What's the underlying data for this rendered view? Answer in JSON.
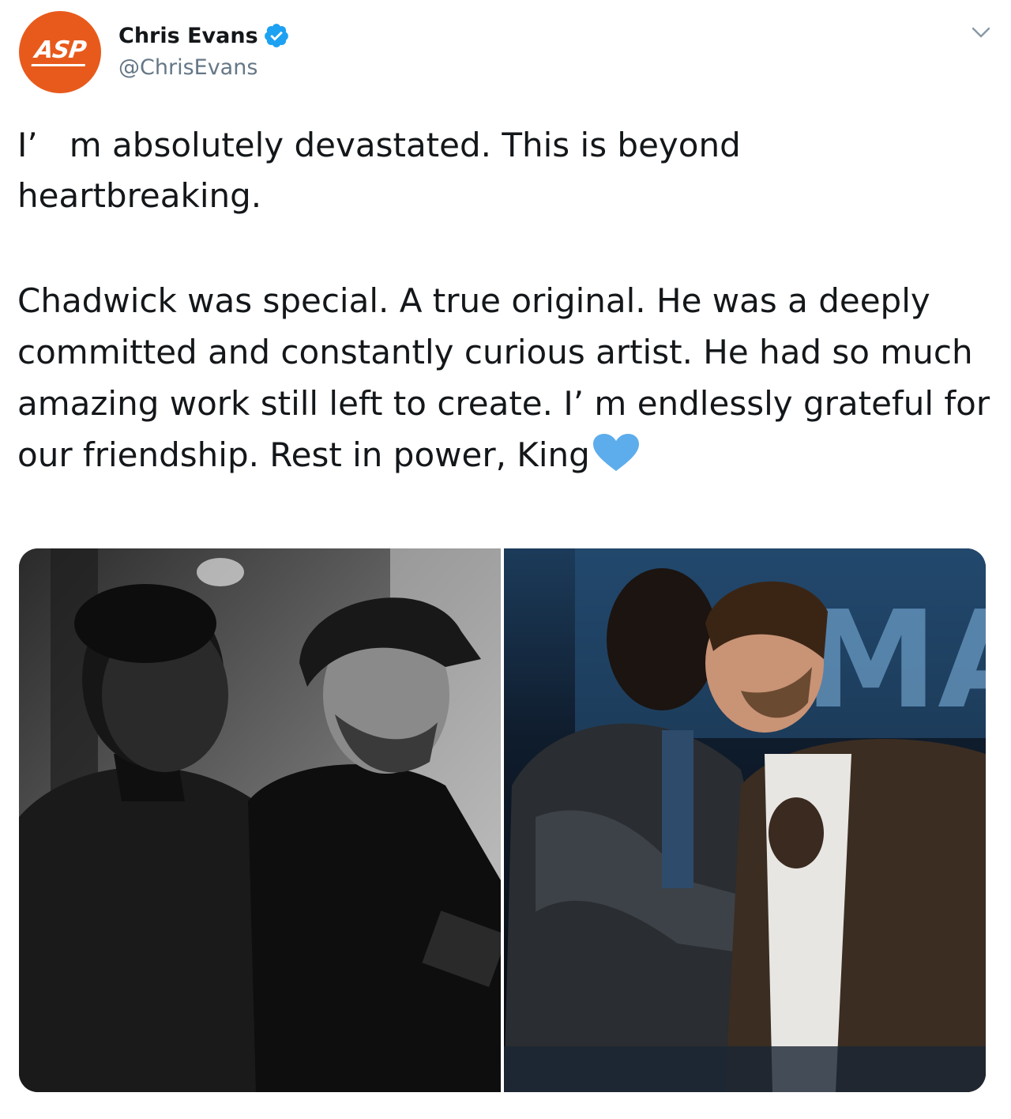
{
  "tweet": {
    "avatar_text": "ASP",
    "display_name": "Chris Evans",
    "handle": "@ChrisEvans",
    "paragraph1": "I’   m absolutely devastated. This is beyond\nheartbreaking.",
    "paragraph2": "Chadwick was special. A true original. He was a deeply committed and constantly curious artist. He had so much amazing work still left to create. I’   m endlessly grateful for our friendship. Rest in power, King",
    "emoji": "blue-heart-icon",
    "banner_text": "MAD"
  },
  "colors": {
    "avatar_bg": "#e85a1c",
    "verified": "#1da1f2",
    "heart": "#5dadec",
    "handle": "#657786",
    "text": "#14171a"
  },
  "media": [
    {
      "type": "photo",
      "style": "black-and-white"
    },
    {
      "type": "photo",
      "style": "color"
    }
  ]
}
